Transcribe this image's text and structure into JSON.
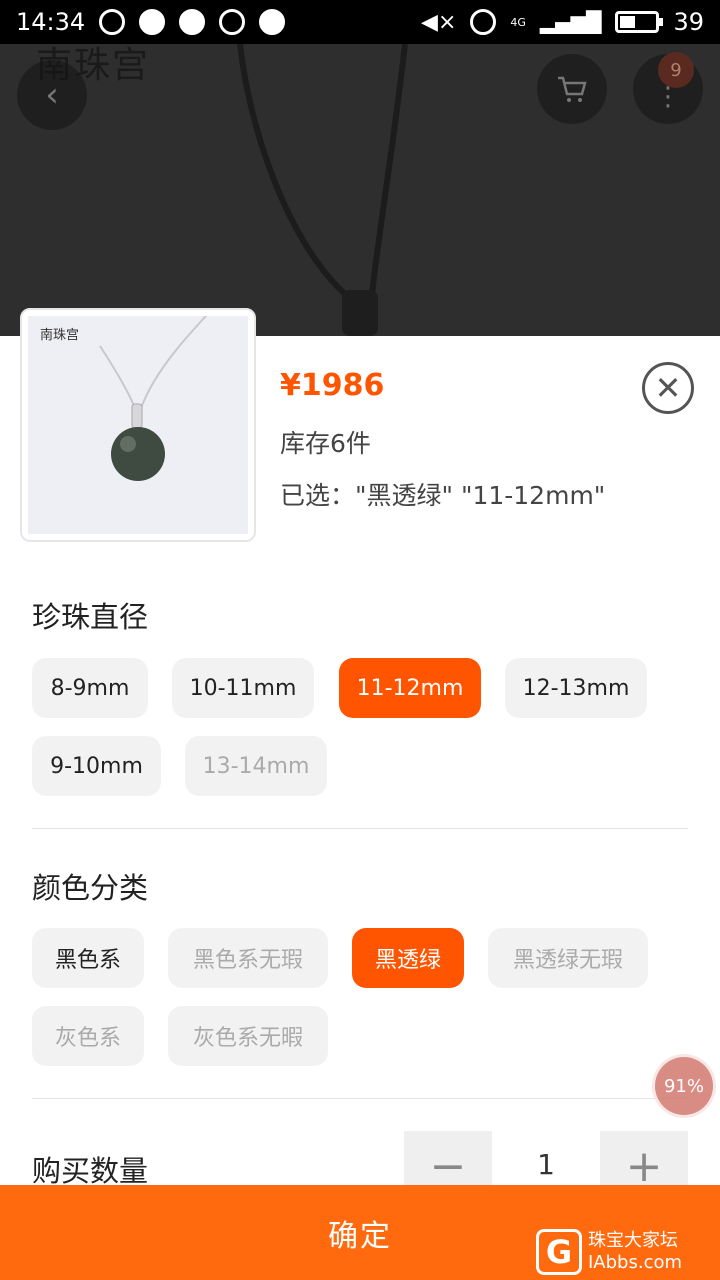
{
  "status_bar": {
    "time": "14:34",
    "battery": "39",
    "network": "4G"
  },
  "hero": {
    "brand_logo": "南珠宫",
    "cart_badge": "9"
  },
  "product": {
    "thumb_brand": "南珠宫",
    "price": "¥1986",
    "stock": "库存6件",
    "selected": "已选：\"黑透绿\" \"11-12mm\""
  },
  "diameter": {
    "title": "珍珠直径",
    "options": [
      {
        "label": "8-9mm",
        "state": "normal"
      },
      {
        "label": "10-11mm",
        "state": "normal"
      },
      {
        "label": "11-12mm",
        "state": "selected"
      },
      {
        "label": "12-13mm",
        "state": "normal"
      },
      {
        "label": "9-10mm",
        "state": "normal"
      },
      {
        "label": "13-14mm",
        "state": "disabled"
      }
    ]
  },
  "color": {
    "title": "颜色分类",
    "options": [
      {
        "label": "黑色系",
        "state": "normal"
      },
      {
        "label": "黑色系无瑕",
        "state": "disabled"
      },
      {
        "label": "黑透绿",
        "state": "selected"
      },
      {
        "label": "黑透绿无瑕",
        "state": "disabled"
      },
      {
        "label": "灰色系",
        "state": "disabled"
      },
      {
        "label": "灰色系无暇",
        "state": "disabled"
      }
    ]
  },
  "quantity": {
    "label": "购买数量",
    "value": "1",
    "minus": "−",
    "plus": "+"
  },
  "confirm_label": "确定",
  "overlay_percent": "91%",
  "watermark": {
    "letter": "G",
    "line1": "珠宝大家坛",
    "line2": "IAbbs.com"
  },
  "colors": {
    "accent": "#ff5500",
    "confirm_bg": "#ff6a0f",
    "chip_bg": "#f2f2f2"
  }
}
